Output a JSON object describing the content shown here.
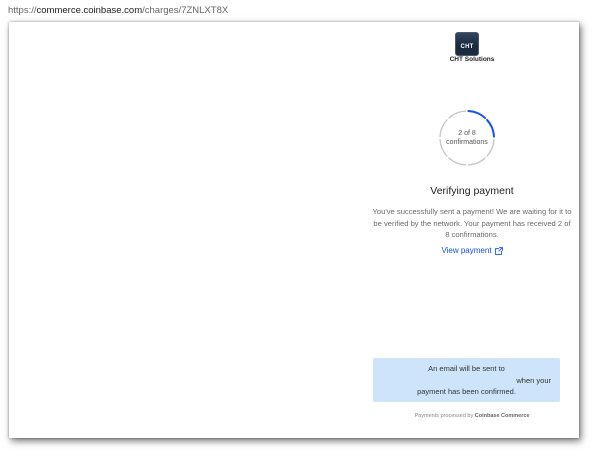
{
  "browser": {
    "url_prefix": "https://",
    "url_host": "commerce.coinbase.com",
    "url_path": "/charges/7ZNLXT8X"
  },
  "merchant": {
    "logo_text": "CHT",
    "name": "CHT Solutions"
  },
  "progress": {
    "line1": "2 of 8",
    "line2": "confirmations",
    "received": 2,
    "required": 8
  },
  "status": {
    "title": "Verifying payment",
    "message": "You've successfully sent a payment! We are waiting for it to be verified by the network. Your payment has received 2 of 8 confirmations.",
    "view_link": "View payment"
  },
  "notice": {
    "line1": "An email will be sent to",
    "line2": "when your",
    "line3": "payment has been confirmed."
  },
  "footer": {
    "prefix": "Payments processed by",
    "brand": "Coinbase Commerce"
  },
  "colors": {
    "accent": "#1652f0",
    "ring_track": "#c8c8c8",
    "notice_bg": "#cde4fb"
  }
}
